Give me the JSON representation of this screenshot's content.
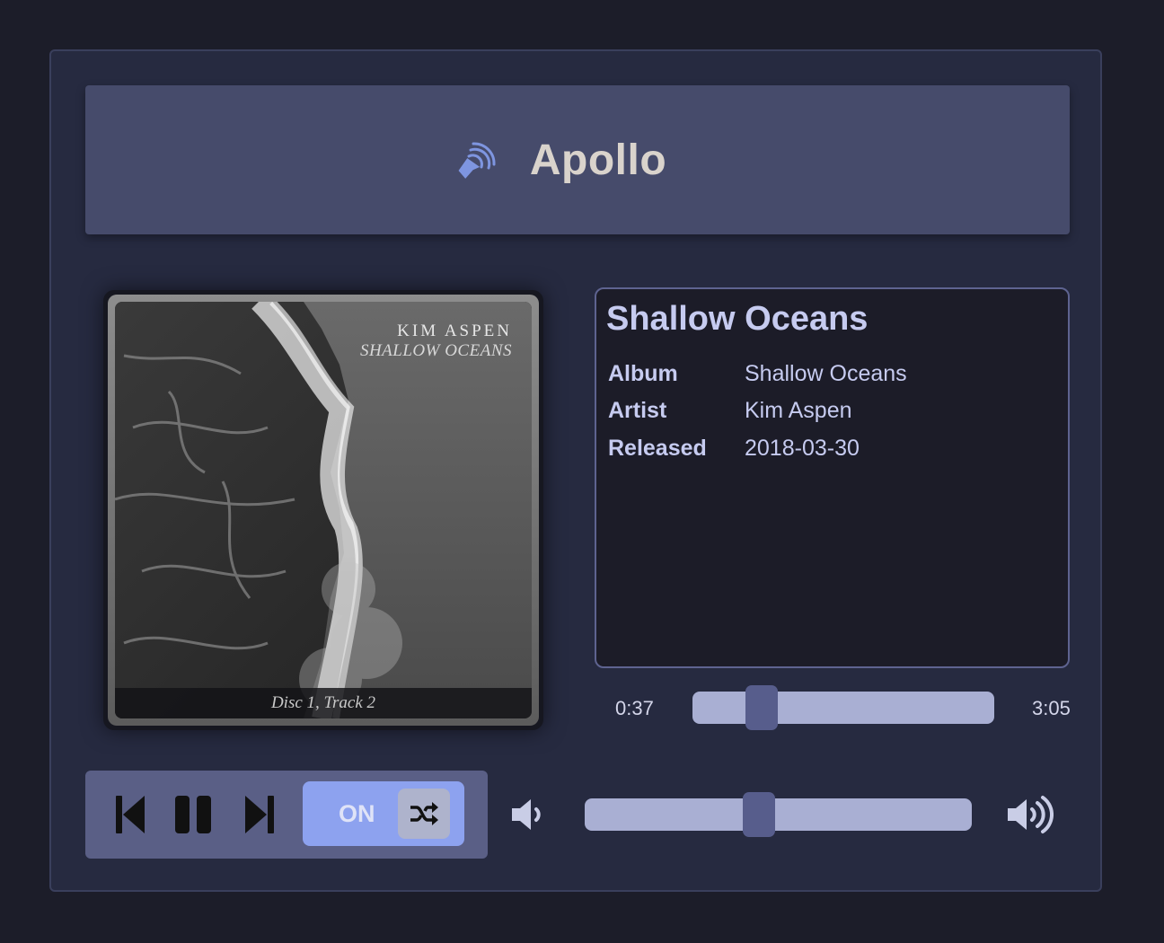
{
  "app": {
    "title": "Apollo",
    "logo_icon": "speaker-waves-icon"
  },
  "now_playing": {
    "cover": {
      "artist_text": "KIM ASPEN",
      "album_text": "SHALLOW OCEANS",
      "caption": "Disc 1, Track 2"
    },
    "title": "Shallow Oceans",
    "details": [
      {
        "label": "Album",
        "value": "Shallow Oceans"
      },
      {
        "label": "Artist",
        "value": "Kim Aspen"
      },
      {
        "label": "Released",
        "value": "2018-03-30"
      }
    ]
  },
  "progress": {
    "elapsed": "0:37",
    "duration": "3:05",
    "fraction": 0.23
  },
  "controls": {
    "prev_icon": "skip-previous-icon",
    "pause_icon": "pause-icon",
    "next_icon": "skip-next-icon",
    "shuffle_label": "ON",
    "shuffle_icon": "shuffle-icon"
  },
  "volume": {
    "low_icon": "volume-low-icon",
    "high_icon": "volume-high-icon",
    "fraction": 0.45
  },
  "colors": {
    "accent": "#8da2ef",
    "panel": "#262a40",
    "header": "#464b6b",
    "text": "#c6cbf0"
  }
}
